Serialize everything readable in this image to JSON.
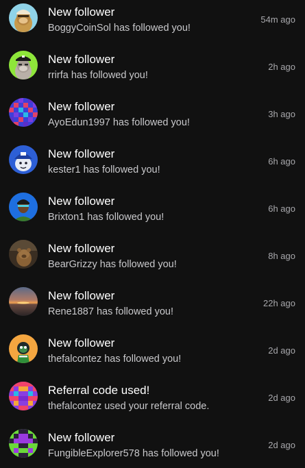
{
  "notifications": [
    {
      "title": "New follower",
      "message": "BoggyCoinSol has followed you!",
      "time": "54m ago",
      "avatar": "ape-avatar-blue-background"
    },
    {
      "title": "New follower",
      "message": "rrirfa has followed you!",
      "time": "2h ago",
      "avatar": "ape-avatar-green-background"
    },
    {
      "title": "New follower",
      "message": "AyoEdun1997 has followed you!",
      "time": "3h ago",
      "avatar": "pixel-pattern-avatar"
    },
    {
      "title": "New follower",
      "message": "kester1 has followed you!",
      "time": "6h ago",
      "avatar": "cartoon-character-avatar"
    },
    {
      "title": "New follower",
      "message": "Brixton1 has followed you!",
      "time": "6h ago",
      "avatar": "illustrated-person-avatar"
    },
    {
      "title": "New follower",
      "message": "BearGrizzy has followed you!",
      "time": "8h ago",
      "avatar": "bear-photo-avatar"
    },
    {
      "title": "New follower",
      "message": "Rene1887 has followed you!",
      "time": "22h ago",
      "avatar": "sunset-photo-avatar"
    },
    {
      "title": "New follower",
      "message": "thefalcontez has followed you!",
      "time": "2d ago",
      "avatar": "cartoon-bird-avatar"
    },
    {
      "title": "Referral code used!",
      "message": "thefalcontez used your referral code.",
      "time": "2d ago",
      "avatar": "pixel-pattern-avatar"
    },
    {
      "title": "New follower",
      "message": "FungibleExplorer578 has followed you!",
      "time": "2d ago",
      "avatar": "pixel-pattern-avatar"
    }
  ],
  "colors": {
    "background": "#111111",
    "title": "#ffffff",
    "message": "#c9c9cc",
    "time": "#a8a8ac"
  }
}
